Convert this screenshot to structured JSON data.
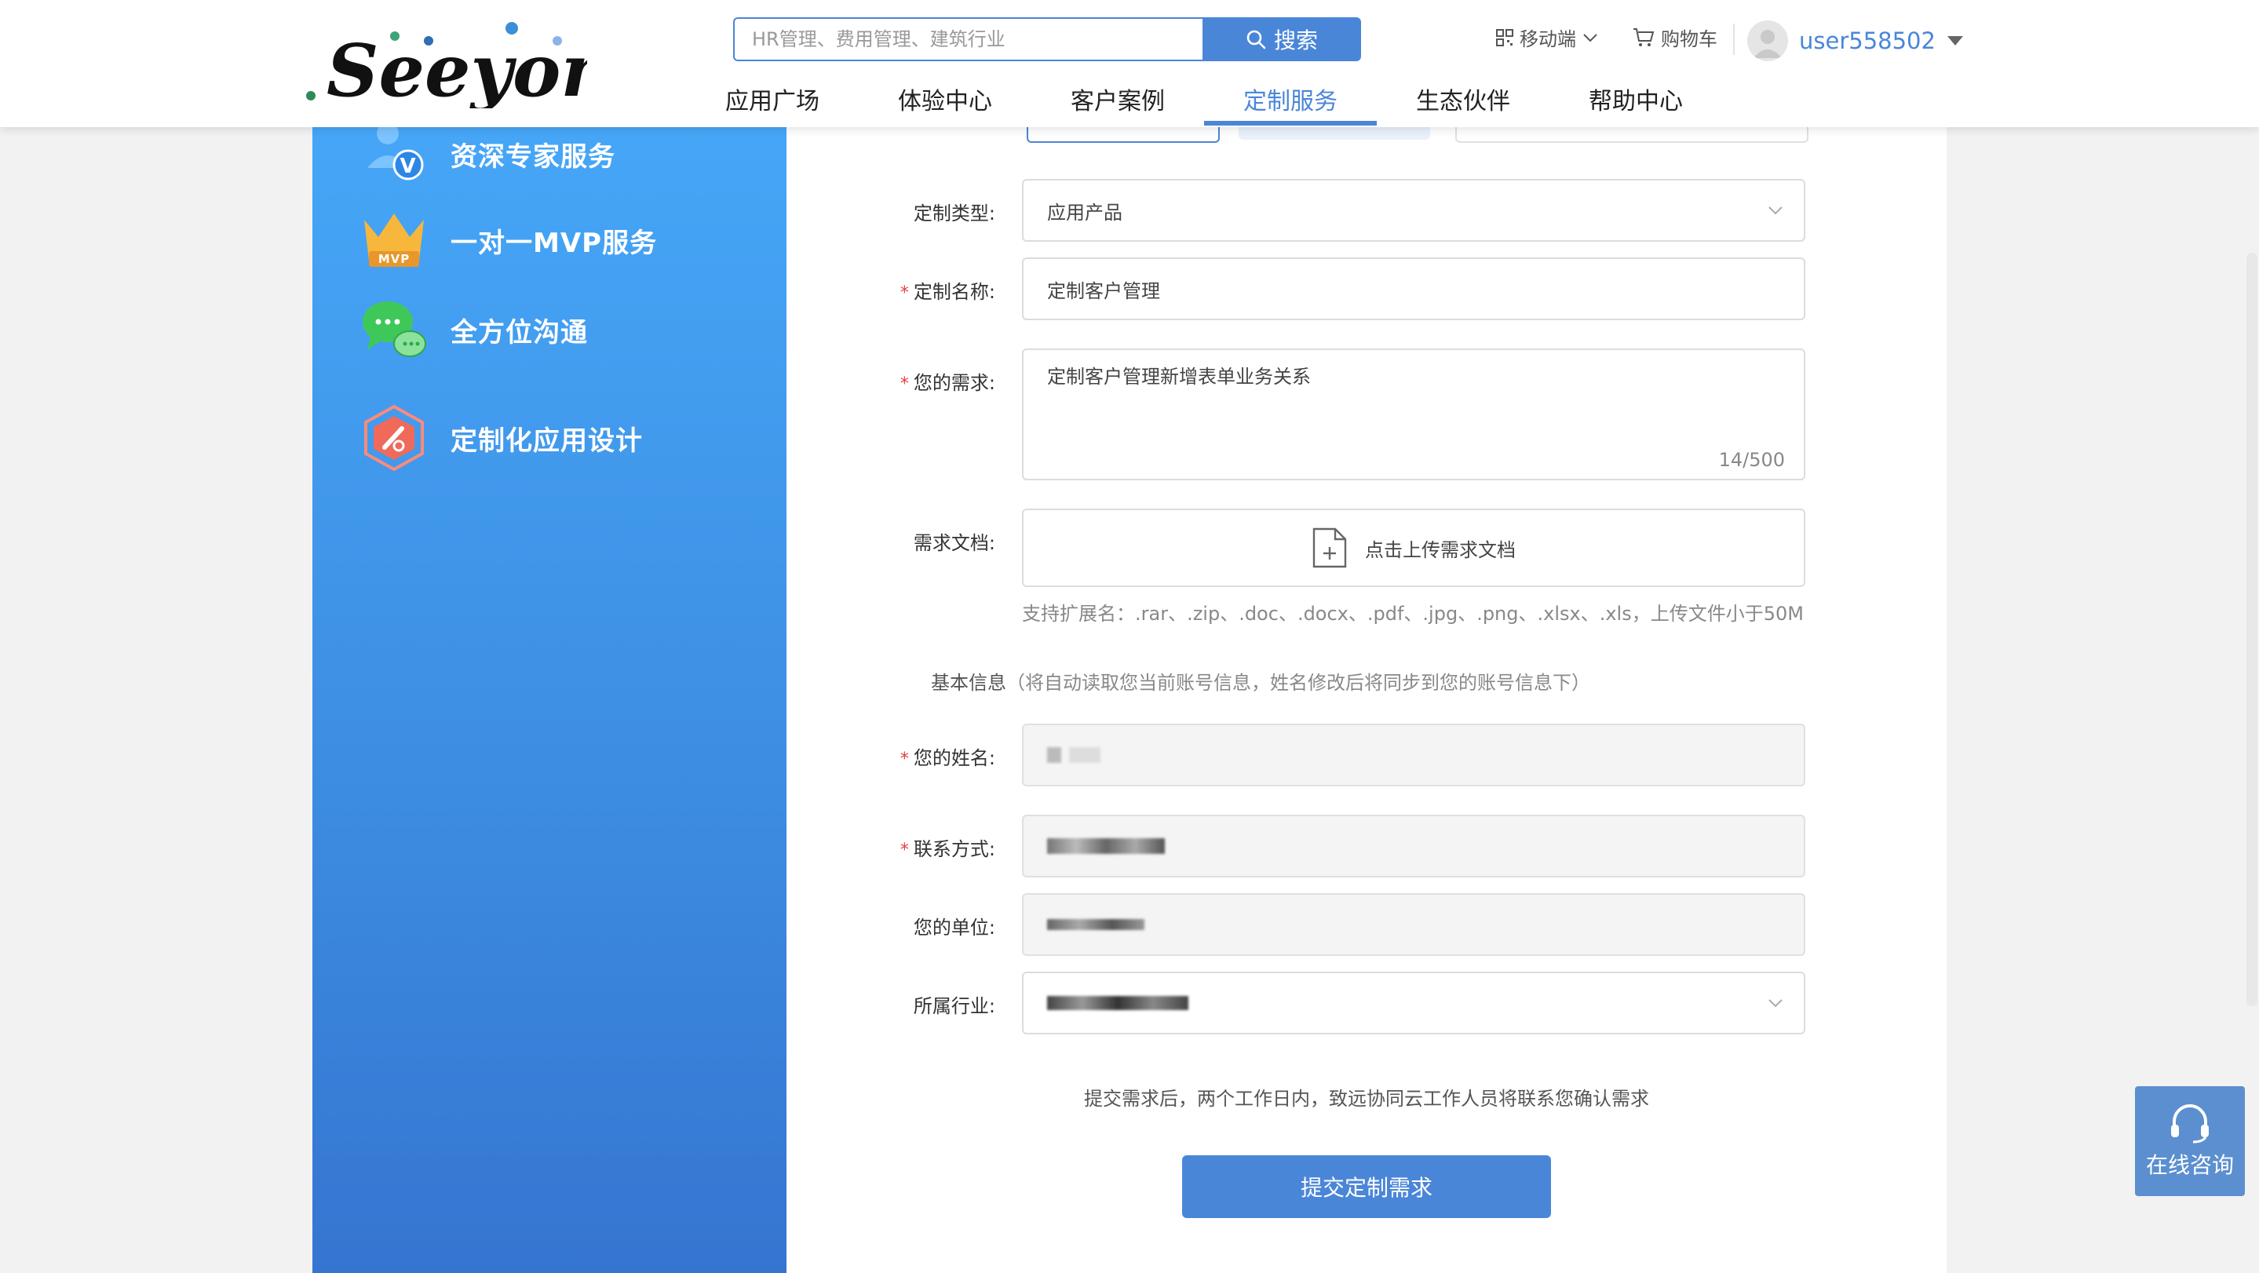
{
  "header": {
    "brand": "Seeyon",
    "search": {
      "placeholder": "HR管理、费用管理、建筑行业",
      "button_label": "搜索"
    },
    "mobile_label": "移动端",
    "cart_label": "购物车",
    "username": "user558502",
    "nav": [
      {
        "label": "应用广场",
        "active": false
      },
      {
        "label": "体验中心",
        "active": false
      },
      {
        "label": "客户案例",
        "active": false
      },
      {
        "label": "定制服务",
        "active": true
      },
      {
        "label": "生态伙伴",
        "active": false
      },
      {
        "label": "帮助中心",
        "active": false
      }
    ]
  },
  "sidebar": {
    "items": [
      {
        "label": "资深专家服务",
        "icon": "expert-icon"
      },
      {
        "label": "一对一MVP服务",
        "icon": "mvp-crown-icon",
        "badge": "MVP"
      },
      {
        "label": "全方位沟通",
        "icon": "chat-bubbles-icon"
      },
      {
        "label": "定制化应用设计",
        "icon": "design-hexagon-icon"
      }
    ]
  },
  "form": {
    "type": {
      "label": "定制类型:",
      "value": "应用产品"
    },
    "name": {
      "label": "定制名称:",
      "value": "定制客户管理",
      "required": true
    },
    "need": {
      "label": "您的需求:",
      "value": "定制客户管理新增表单业务关系",
      "counter": "14/500",
      "required": true
    },
    "doc": {
      "label": "需求文档:",
      "upload_label": "点击上传需求文档",
      "hint": "支持扩展名：.rar、.zip、.doc、.docx、.pdf、.jpg、.png、.xlsx、.xls，上传文件小于50M"
    },
    "basic_info": {
      "title": "基本信息",
      "note": "（将自动读取您当前账号信息，姓名修改后将同步到您的账号信息下）"
    },
    "user_name": {
      "label": "您的姓名:",
      "required": true
    },
    "contact": {
      "label": "联系方式:",
      "required": true
    },
    "company": {
      "label": "您的单位:"
    },
    "industry": {
      "label": "所属行业:"
    },
    "submit_note": "提交需求后，两个工作日内，致远协同云工作人员将联系您确认需求",
    "submit_label": "提交定制需求"
  },
  "consult": {
    "label": "在线咨询"
  },
  "colors": {
    "primary": "#4a86d8",
    "sidebar_top": "#46a6f7",
    "sidebar_bottom": "#3575d1",
    "required": "#e54141"
  }
}
